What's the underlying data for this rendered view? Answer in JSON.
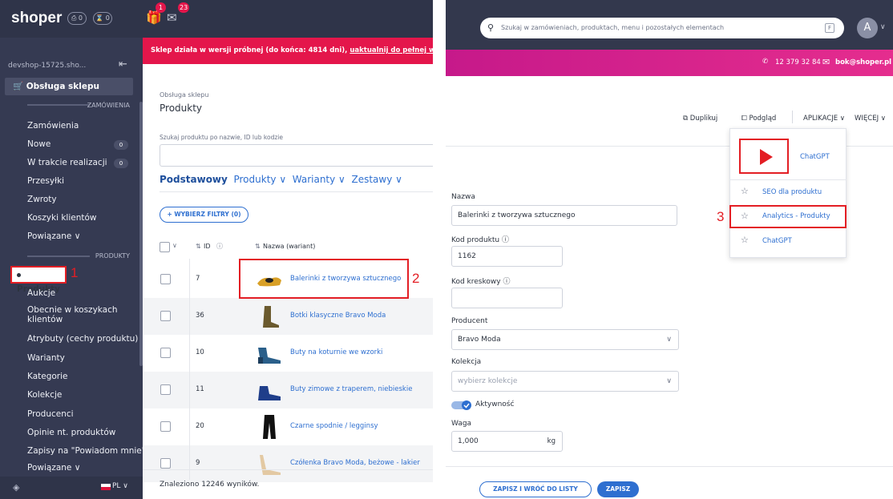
{
  "colors": {
    "accent": "#2e6fd0",
    "annotation": "#e31e24",
    "banner": "#e4164b",
    "sidebar": "#353a52"
  },
  "left": {
    "logo": "shoper",
    "header_counters": [
      "0",
      "0"
    ],
    "gift_badge": "1",
    "mail_badge": "23",
    "shop_name": "devshop-15725.sho...",
    "section": "Obsługa sklepu",
    "group_orders": "ZAMÓWIENIA",
    "orders_items": [
      {
        "label": "Zamówienia"
      },
      {
        "label": "Nowe",
        "badge": "0"
      },
      {
        "label": "W trakcie realizacji",
        "badge": "0"
      },
      {
        "label": "Przesyłki"
      },
      {
        "label": "Zwroty"
      },
      {
        "label": "Koszyki klientów"
      },
      {
        "label": "Powiązane ∨"
      }
    ],
    "group_products": "PRODUKTY",
    "active_item": "Produkty",
    "products_items": [
      "Aukcje",
      "Obecnie w koszykach\nklientów",
      "Atrybuty (cechy produktu)",
      "Warianty",
      "Kategorie",
      "Kolekcje",
      "Producenci",
      "Opinie nt. produktów",
      "Zapisy na \"Powiadom mnie\"",
      "Powiązane ∨"
    ],
    "footer_lang": "PL ∨",
    "annotation_1": "1",
    "banner": {
      "text": "Sklep działa w wersji próbnej (do końca: 4814 dni), ",
      "link": "uaktualnij do pełnej wersji",
      "end": "."
    },
    "breadcrumb": "Obsługa sklepu",
    "page_title": "Produkty",
    "search_label": "Szukaj produktu po nazwie, ID lub kodzie",
    "tabs": {
      "active": "Podstawowy",
      "others": [
        "Produkty ∨",
        "Warianty ∨",
        "Zestawy ∨"
      ]
    },
    "filter_button": "+ WYBIERZ FILTRY (0)",
    "col_id": "ID",
    "col_name": "Nazwa (wariant)",
    "rows": [
      {
        "id": "7",
        "name": "Balerinki z tworzywa sztucznego"
      },
      {
        "id": "36",
        "name": "Botki klasyczne Bravo Moda"
      },
      {
        "id": "10",
        "name": "Buty na koturnie we wzorki"
      },
      {
        "id": "11",
        "name": "Buty zimowe z traperem, niebieskie"
      },
      {
        "id": "20",
        "name": "Czarne spodnie / legginsy"
      },
      {
        "id": "9",
        "name": "Czółenka Bravo Moda, beżowe - lakier"
      }
    ],
    "annotation_2": "2",
    "results": "Znaleziono 12246 wyników."
  },
  "right": {
    "search_placeholder": "Szukaj w zamówieniach, produktach, menu i pozostałych elementach",
    "search_key": "F",
    "avatar": "A",
    "phone": "12 379 32 84",
    "email": "bok@shoper.pl",
    "toolbar": {
      "duplicate": "Duplikuj",
      "preview": "Podgląd",
      "apps": "APLIKACJE ∨",
      "more": "WIĘCEJ ∨"
    },
    "menu": {
      "featured": "ChatGPT",
      "items": [
        "SEO dla produktu",
        "Analytics - Produkty",
        "ChatGPT"
      ]
    },
    "annotation_3": "3",
    "form": {
      "name_label": "Nazwa",
      "name_value": "Balerinki z tworzywa sztucznego",
      "code_label": "Kod produktu",
      "code_value": "1162",
      "barcode_label": "Kod kreskowy",
      "producer_label": "Producent",
      "producer_value": "Bravo Moda",
      "collection_label": "Kolekcja",
      "collection_placeholder": "wybierz kolekcje",
      "active_label": "Aktywność",
      "weight_label": "Waga",
      "weight_value": "1,000",
      "weight_unit": "kg"
    },
    "save_back": "ZAPISZ I WRÓĆ DO LISTY",
    "save": "ZAPISZ"
  }
}
